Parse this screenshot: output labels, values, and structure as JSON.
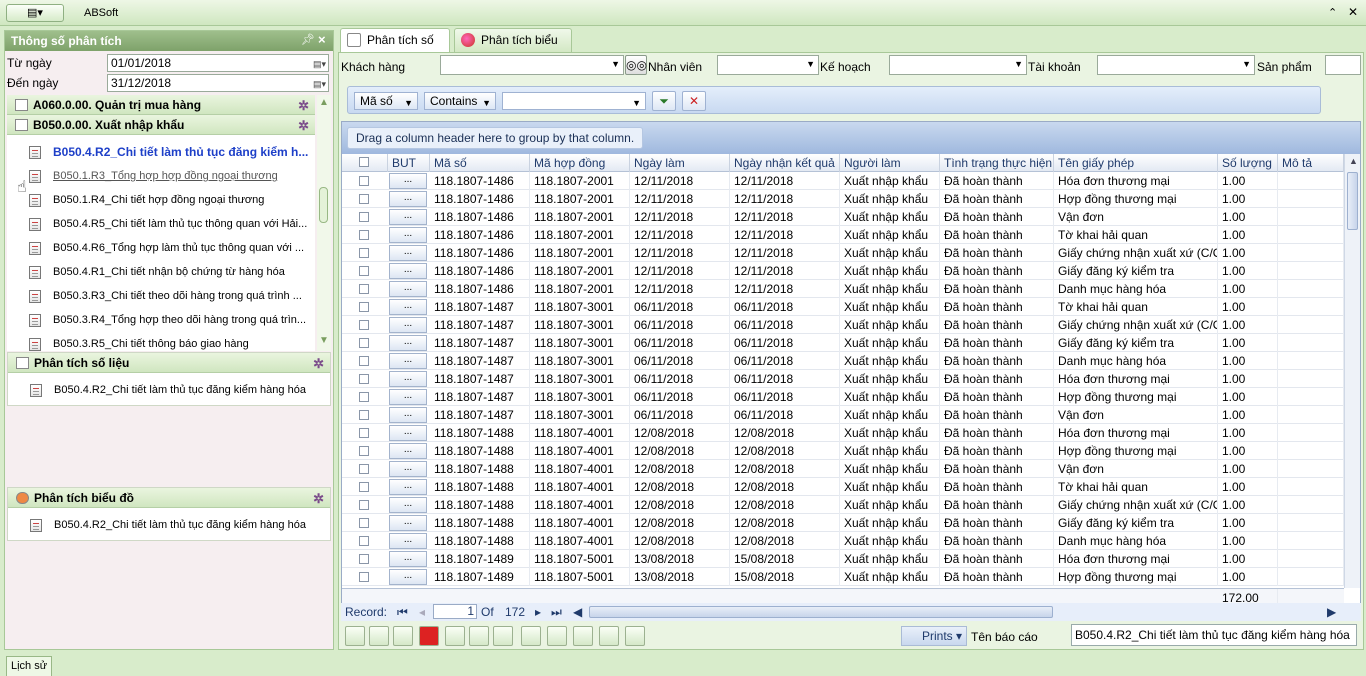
{
  "app": {
    "title": "ABSoft",
    "menu_icon": "menu-icon"
  },
  "left_panel": {
    "title": "Thông số phân tích",
    "from_label": "Từ ngày",
    "from_value": "01/01/2018",
    "to_label": "Đến ngày",
    "to_value": "31/12/2018",
    "groups": [
      {
        "label": "A060.0.00. Quản trị mua hàng"
      },
      {
        "label": "B050.0.00. Xuất nhập khẩu"
      }
    ],
    "tree_items": [
      "B050.4.R2_Chi tiết làm thủ tục đăng kiểm h...",
      "B050.1.R3_Tổng hợp hợp đồng ngoại thương",
      "B050.1.R4_Chi tiết hợp đồng ngoại thương",
      "B050.4.R5_Chi tiết làm thủ tục thông quan với Hải...",
      "B050.4.R6_Tổng hợp làm thủ tục thông quan với ...",
      "B050.4.R1_Chi tiết nhận bộ chứng từ hàng hóa",
      "B050.3.R3_Chi tiết theo dõi hàng trong quá trình ...",
      "B050.3.R4_Tổng hợp theo dõi hàng trong quá trìn...",
      "B050.3.R5_Chi tiết thông báo giao hàng"
    ],
    "section_numbers": {
      "title": "Phân tích số liệu",
      "item": "B050.4.R2_Chi tiết làm thủ tục đăng kiểm hàng hóa"
    },
    "section_chart": {
      "title": "Phân tích biểu đồ",
      "item": "B050.4.R2_Chi tiết làm thủ tục đăng kiểm hàng hóa"
    }
  },
  "tabs": [
    {
      "label": "Phân tích số liệu",
      "active": true
    },
    {
      "label": "Phân tích biểu đồ",
      "active": false
    }
  ],
  "filters": {
    "customer": "Khách hàng",
    "employee": "Nhân viên",
    "plan": "Kế hoạch",
    "account": "Tài khoản",
    "product": "Sản phẩm",
    "field": "Mã số",
    "operator": "Contains",
    "value": ""
  },
  "grid": {
    "group_hint": "Drag a column header here to group by that column.",
    "columns": [
      "BUT",
      "Mã số",
      "Mã hợp đồng",
      "Ngày làm",
      "Ngày nhận kết quả",
      "Người làm",
      "Tình trạng thực hiện",
      "Tên giấy phép",
      "Số lượng",
      "Mô tả"
    ],
    "rows": [
      [
        "...",
        "118.1807-1486",
        "118.1807-2001",
        "12/11/2018",
        "12/11/2018",
        "Xuất nhập khẩu",
        "Đã hoàn thành",
        "Hóa đơn thương mại",
        "1.00",
        ""
      ],
      [
        "...",
        "118.1807-1486",
        "118.1807-2001",
        "12/11/2018",
        "12/11/2018",
        "Xuất nhập khẩu",
        "Đã hoàn thành",
        "Hợp đồng thương mại",
        "1.00",
        ""
      ],
      [
        "...",
        "118.1807-1486",
        "118.1807-2001",
        "12/11/2018",
        "12/11/2018",
        "Xuất nhập khẩu",
        "Đã hoàn thành",
        "Vận đơn",
        "1.00",
        ""
      ],
      [
        "...",
        "118.1807-1486",
        "118.1807-2001",
        "12/11/2018",
        "12/11/2018",
        "Xuất nhập khẩu",
        "Đã hoàn thành",
        "Tờ khai hải quan",
        "1.00",
        ""
      ],
      [
        "...",
        "118.1807-1486",
        "118.1807-2001",
        "12/11/2018",
        "12/11/2018",
        "Xuất nhập khẩu",
        "Đã hoàn thành",
        "Giấy chứng nhận xuất xứ (C/O)",
        "1.00",
        ""
      ],
      [
        "...",
        "118.1807-1486",
        "118.1807-2001",
        "12/11/2018",
        "12/11/2018",
        "Xuất nhập khẩu",
        "Đã hoàn thành",
        "Giấy đăng ký kiểm tra",
        "1.00",
        ""
      ],
      [
        "...",
        "118.1807-1486",
        "118.1807-2001",
        "12/11/2018",
        "12/11/2018",
        "Xuất nhập khẩu",
        "Đã hoàn thành",
        "Danh mục hàng hóa",
        "1.00",
        ""
      ],
      [
        "...",
        "118.1807-1487",
        "118.1807-3001",
        "06/11/2018",
        "06/11/2018",
        "Xuất nhập khẩu",
        "Đã hoàn thành",
        "Tờ khai hải quan",
        "1.00",
        ""
      ],
      [
        "...",
        "118.1807-1487",
        "118.1807-3001",
        "06/11/2018",
        "06/11/2018",
        "Xuất nhập khẩu",
        "Đã hoàn thành",
        "Giấy chứng nhận xuất xứ (C/O)",
        "1.00",
        ""
      ],
      [
        "...",
        "118.1807-1487",
        "118.1807-3001",
        "06/11/2018",
        "06/11/2018",
        "Xuất nhập khẩu",
        "Đã hoàn thành",
        "Giấy đăng ký kiểm tra",
        "1.00",
        ""
      ],
      [
        "...",
        "118.1807-1487",
        "118.1807-3001",
        "06/11/2018",
        "06/11/2018",
        "Xuất nhập khẩu",
        "Đã hoàn thành",
        "Danh mục hàng hóa",
        "1.00",
        ""
      ],
      [
        "...",
        "118.1807-1487",
        "118.1807-3001",
        "06/11/2018",
        "06/11/2018",
        "Xuất nhập khẩu",
        "Đã hoàn thành",
        "Hóa đơn thương mại",
        "1.00",
        ""
      ],
      [
        "...",
        "118.1807-1487",
        "118.1807-3001",
        "06/11/2018",
        "06/11/2018",
        "Xuất nhập khẩu",
        "Đã hoàn thành",
        "Hợp đồng thương mại",
        "1.00",
        ""
      ],
      [
        "...",
        "118.1807-1487",
        "118.1807-3001",
        "06/11/2018",
        "06/11/2018",
        "Xuất nhập khẩu",
        "Đã hoàn thành",
        "Vận đơn",
        "1.00",
        ""
      ],
      [
        "...",
        "118.1807-1488",
        "118.1807-4001",
        "12/08/2018",
        "12/08/2018",
        "Xuất nhập khẩu",
        "Đã hoàn thành",
        "Hóa đơn thương mại",
        "1.00",
        ""
      ],
      [
        "...",
        "118.1807-1488",
        "118.1807-4001",
        "12/08/2018",
        "12/08/2018",
        "Xuất nhập khẩu",
        "Đã hoàn thành",
        "Hợp đồng thương mại",
        "1.00",
        ""
      ],
      [
        "...",
        "118.1807-1488",
        "118.1807-4001",
        "12/08/2018",
        "12/08/2018",
        "Xuất nhập khẩu",
        "Đã hoàn thành",
        "Vận đơn",
        "1.00",
        ""
      ],
      [
        "...",
        "118.1807-1488",
        "118.1807-4001",
        "12/08/2018",
        "12/08/2018",
        "Xuất nhập khẩu",
        "Đã hoàn thành",
        "Tờ khai hải quan",
        "1.00",
        ""
      ],
      [
        "...",
        "118.1807-1488",
        "118.1807-4001",
        "12/08/2018",
        "12/08/2018",
        "Xuất nhập khẩu",
        "Đã hoàn thành",
        "Giấy chứng nhận xuất xứ (C/O)",
        "1.00",
        ""
      ],
      [
        "...",
        "118.1807-1488",
        "118.1807-4001",
        "12/08/2018",
        "12/08/2018",
        "Xuất nhập khẩu",
        "Đã hoàn thành",
        "Giấy đăng ký kiểm tra",
        "1.00",
        ""
      ],
      [
        "...",
        "118.1807-1488",
        "118.1807-4001",
        "12/08/2018",
        "12/08/2018",
        "Xuất nhập khẩu",
        "Đã hoàn thành",
        "Danh mục hàng hóa",
        "1.00",
        ""
      ],
      [
        "...",
        "118.1807-1489",
        "118.1807-5001",
        "13/08/2018",
        "15/08/2018",
        "Xuất nhập khẩu",
        "Đã hoàn thành",
        "Hóa đơn thương mại",
        "1.00",
        ""
      ],
      [
        "...",
        "118.1807-1489",
        "118.1807-5001",
        "13/08/2018",
        "15/08/2018",
        "Xuất nhập khẩu",
        "Đã hoàn thành",
        "Hợp đồng thương mại",
        "1.00",
        ""
      ]
    ],
    "total": "172.00"
  },
  "nav": {
    "record_label": "Record:",
    "current": "1",
    "of_label": "Of",
    "total": "172"
  },
  "bottom": {
    "prints_label": "Prints",
    "report_label": "Tên báo cáo",
    "report_value": "B050.4.R2_Chi tiết làm thủ tục đăng kiểm hàng hóa"
  },
  "status": {
    "history_tab": "Lịch sử"
  }
}
